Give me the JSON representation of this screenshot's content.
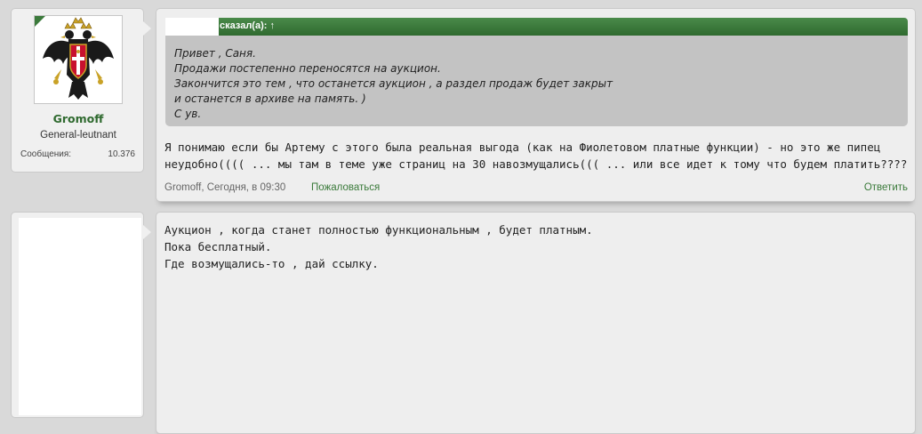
{
  "posts": [
    {
      "user": {
        "name": "Gromoff",
        "title": "General-leutnant",
        "stats_label": "Сообщения:",
        "stats_value": "10.376",
        "avatar_icon": "double-headed-eagle-coat-of-arms"
      },
      "quote": {
        "header": "сказал(а): ↑",
        "lines": [
          "Привет , Саня.",
          "Продажи постепенно переносятся на аукцион.",
          "Закончится это тем , что останется аукцион , а раздел продаж будет закрыт",
          "и останется в архиве на память. )",
          "С ув."
        ]
      },
      "text_lines": [
        "Я понимаю если бы Артему с этого была реальная выгода (как на Фиолетовом платные функции) - но это же пипец",
        "неудобно(((( ... мы там в теме уже страниц на 30 навозмущались((( ... или все идет к тому что будем платить????"
      ],
      "meta": "Gromoff, Сегодня, в 09:30",
      "report_label": "Пожаловаться",
      "reply_label": "Ответить"
    },
    {
      "text_lines": [
        "Аукцион , когда станет полностью функциональным , будет платным.",
        "Пока бесплатный.",
        "Где возмущались-то , дай ссылку."
      ]
    }
  ],
  "colors": {
    "accent_green": "#2f6a2f",
    "link_green": "#3a7a3a",
    "quote_bg": "#c3c3c3",
    "page_bg": "#d9d9d9"
  }
}
